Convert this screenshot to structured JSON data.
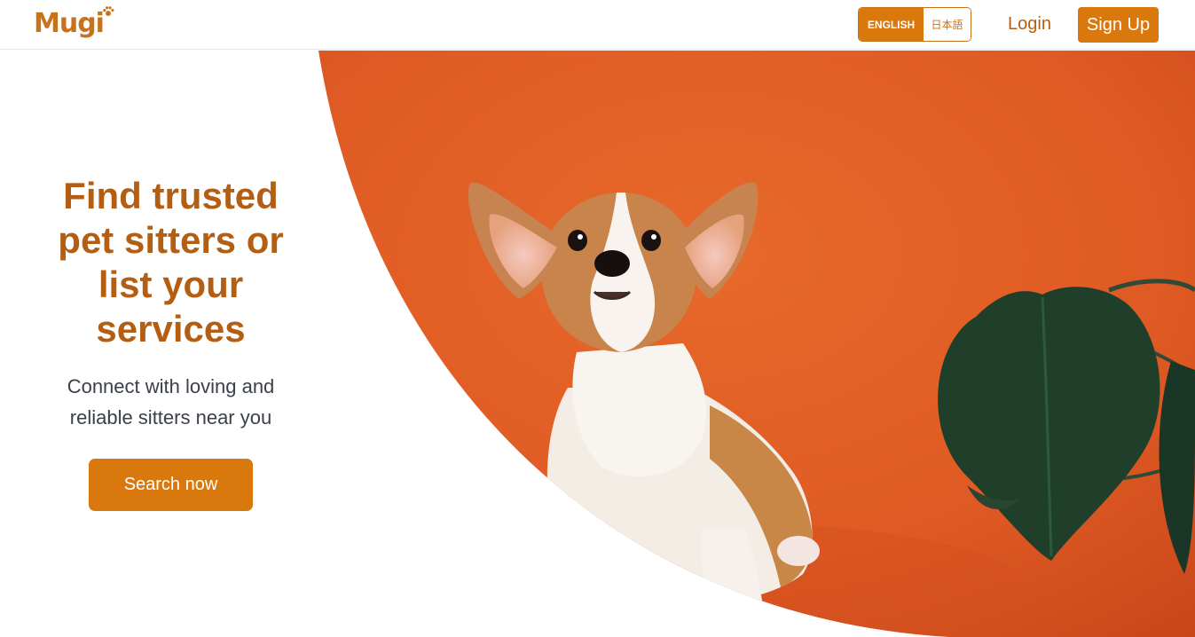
{
  "brand": {
    "logo_text": "Mugi",
    "accent_color": "#d9780d",
    "title_color": "#b35e12",
    "hero_background": "#df5a24"
  },
  "header": {
    "language": {
      "english_label": "ENGLISH",
      "japanese_label": "日本語",
      "selected": "ENGLISH"
    },
    "login_label": "Login",
    "signup_label": "Sign Up"
  },
  "hero": {
    "title": "Find trusted pet sitters or list your services",
    "subtitle": "Connect with loving and reliable sitters near you",
    "cta_label": "Search now",
    "image_subject": "corgi puppy with plant leaf on orange background"
  },
  "icons": {
    "logo_mark": "paw-icon"
  }
}
